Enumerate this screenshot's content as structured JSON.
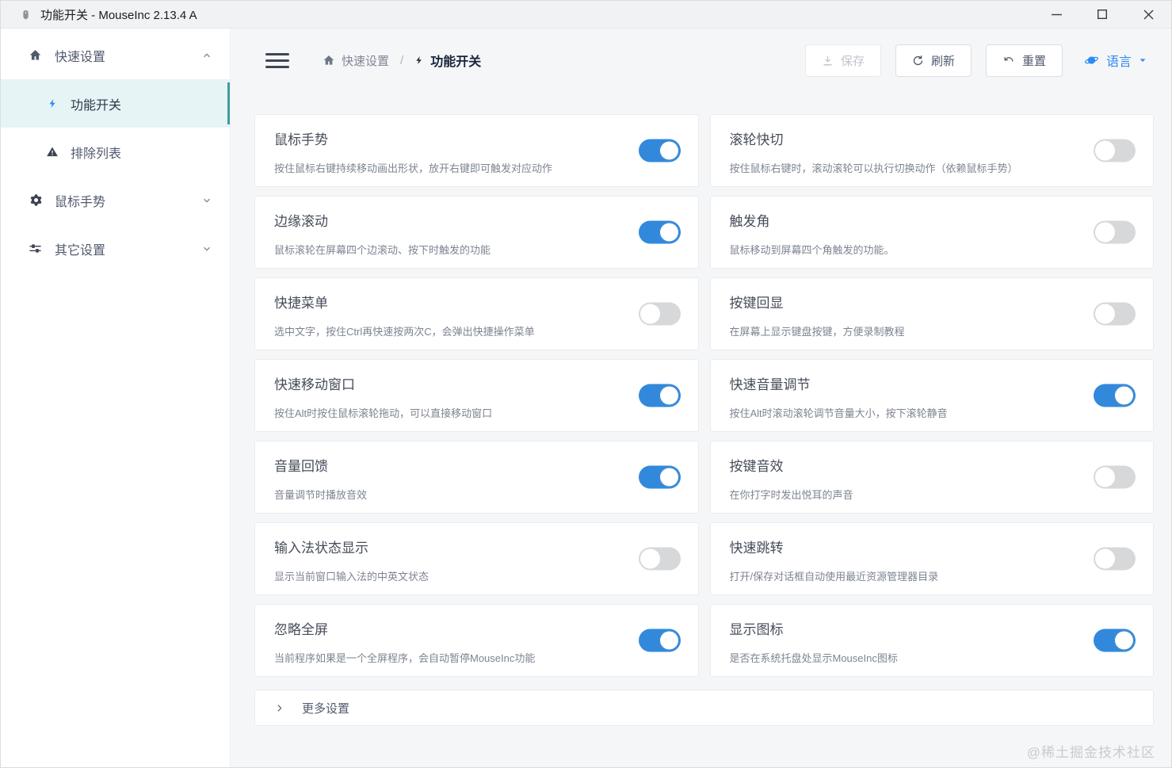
{
  "window": {
    "title": "功能开关 - MouseInc 2.13.4 A"
  },
  "sidebar": {
    "groups": [
      {
        "label": "快速设置",
        "icon": "home-icon",
        "expanded": true
      },
      {
        "label": "鼠标手势",
        "icon": "gear-icon",
        "expanded": false
      },
      {
        "label": "其它设置",
        "icon": "sliders-icon",
        "expanded": false
      }
    ],
    "quick_children": [
      {
        "label": "功能开关",
        "icon": "lightning-icon",
        "active": true
      },
      {
        "label": "排除列表",
        "icon": "warning-icon",
        "active": false
      }
    ]
  },
  "toolbar": {
    "breadcrumb": [
      {
        "label": "快速设置",
        "icon": "home-icon"
      },
      {
        "label": "功能开关",
        "icon": "lightning-icon"
      }
    ],
    "separator": "/",
    "save_label": "保存",
    "refresh_label": "刷新",
    "reset_label": "重置",
    "language_label": "语言"
  },
  "cards": [
    {
      "title": "鼠标手势",
      "description": "按住鼠标右键持续移动画出形状，放开右键即可触发对应动作",
      "enabled": true
    },
    {
      "title": "滚轮快切",
      "description": "按住鼠标右键时，滚动滚轮可以执行切换动作（依赖鼠标手势）",
      "enabled": false
    },
    {
      "title": "边缘滚动",
      "description": "鼠标滚轮在屏幕四个边滚动、按下时触发的功能",
      "enabled": true
    },
    {
      "title": "触发角",
      "description": "鼠标移动到屏幕四个角触发的功能。",
      "enabled": false
    },
    {
      "title": "快捷菜单",
      "description": "选中文字，按住Ctrl再快速按两次C，会弹出快捷操作菜单",
      "enabled": false
    },
    {
      "title": "按键回显",
      "description": "在屏幕上显示键盘按键，方便录制教程",
      "enabled": false
    },
    {
      "title": "快速移动窗口",
      "description": "按住Alt时按住鼠标滚轮拖动，可以直接移动窗口",
      "enabled": true
    },
    {
      "title": "快速音量调节",
      "description": "按住Alt时滚动滚轮调节音量大小，按下滚轮静音",
      "enabled": true
    },
    {
      "title": "音量回馈",
      "description": "音量调节时播放音效",
      "enabled": true
    },
    {
      "title": "按键音效",
      "description": "在你打字时发出悦耳的声音",
      "enabled": false
    },
    {
      "title": "输入法状态显示",
      "description": "显示当前窗口输入法的中英文状态",
      "enabled": false
    },
    {
      "title": "快速跳转",
      "description": "打开/保存对话框自动使用最近资源管理器目录",
      "enabled": false
    },
    {
      "title": "忽略全屏",
      "description": "当前程序如果是一个全屏程序，会自动暂停MouseInc功能",
      "enabled": true
    },
    {
      "title": "显示图标",
      "description": "是否在系统托盘处显示MouseInc图标",
      "enabled": true
    }
  ],
  "more_settings": {
    "label": "更多设置"
  },
  "watermark": "@稀土掘金技术社区",
  "colors": {
    "toggle_on": "#3289dc",
    "toggle_off": "#d6d8da",
    "accent_blue": "#2d8cf0",
    "active_indicator_teal": "#3e9c9a",
    "active_item_bg": "#e7f4f6"
  }
}
